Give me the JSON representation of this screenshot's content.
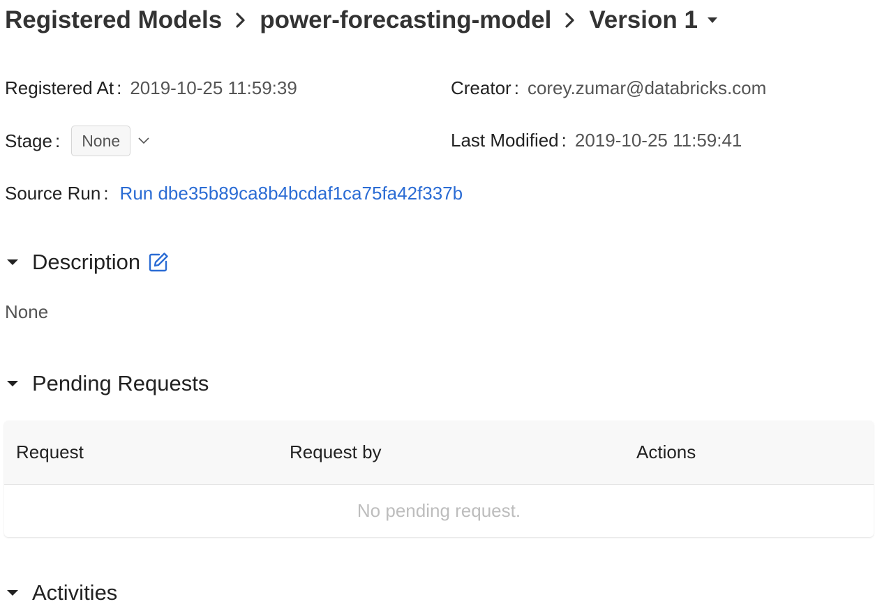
{
  "breadcrumb": {
    "root": "Registered Models",
    "model": "power-forecasting-model",
    "version": "Version 1"
  },
  "meta": {
    "registered_at_label": "Registered At",
    "registered_at_value": "2019-10-25 11:59:39",
    "creator_label": "Creator",
    "creator_value": "corey.zumar@databricks.com",
    "stage_label": "Stage",
    "stage_value": "None",
    "last_modified_label": "Last Modified",
    "last_modified_value": "2019-10-25 11:59:41",
    "source_run_label": "Source Run",
    "source_run_value": "Run dbe35b89ca8b4bcdaf1ca75fa42f337b",
    "separator": ":"
  },
  "sections": {
    "description": {
      "title": "Description",
      "body": "None"
    },
    "pending_requests": {
      "title": "Pending Requests",
      "columns": [
        "Request",
        "Request by",
        "Actions"
      ],
      "empty_text": "No pending request."
    },
    "activities": {
      "title": "Activities"
    }
  },
  "colors": {
    "link": "#2b6cd4",
    "text": "#333333",
    "muted": "#555555",
    "empty": "#bdbdbd"
  },
  "icons": {
    "breadcrumb_separator": "chevron-right-icon",
    "version_dropdown": "caret-down-icon",
    "stage_dropdown": "chevron-down-icon",
    "section_toggle": "caret-down-icon",
    "edit": "edit-icon"
  }
}
